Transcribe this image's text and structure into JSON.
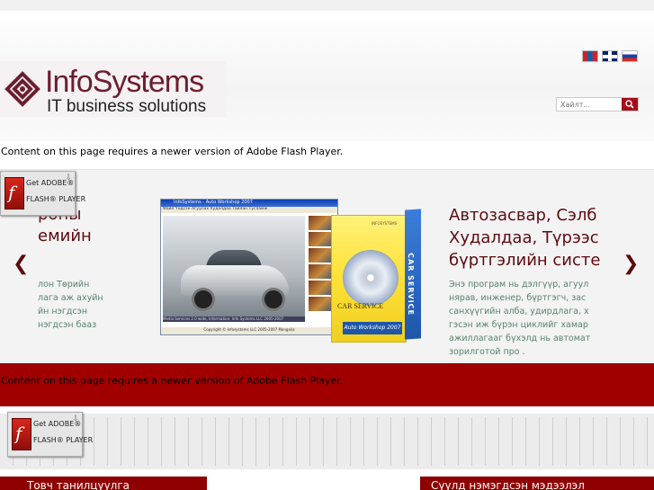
{
  "header": {
    "logo_name": "InfoSystems",
    "logo_tagline": "IT business solutions",
    "languages": [
      "mongolian-flag",
      "english-flag",
      "russian-flag"
    ],
    "search": {
      "placeholder": "Хайлт..."
    }
  },
  "flash": {
    "message": "Content on this page requires a newer version of Adobe Flash Player.",
    "get_label": "Get ADOBE®",
    "player_label": "FLASH® PLAYER"
  },
  "slider": {
    "left_title": "роны\nемийн",
    "left_text": "лон Төрийн\nлага аж ахуйн\nйн нэгдсэн\nнэгдсэн бааз",
    "screenshot": {
      "window_title": "InfoSystems - Auto Workshop 2007",
      "menu": "Файл  Үндсэн  Агуулах  Худалдаа  Тайлан  Тусламж",
      "strip_text": "Media Services 2.0 wide, Information: Info Systems LLC 2005-2007",
      "status": "Copyright © Infosystems LLC 2005-2007 Mongolia"
    },
    "product_box": {
      "top_label": "INFOSYSTEMS",
      "title": "CAR SERVICE",
      "subtitle": "Auto Workshop 2007",
      "side_label": "CAR SERVICE"
    },
    "right_title": "Автозасвар, Сэлб\nХудалдаа, Түрээс\nбүртгэлийн систе",
    "right_text": "Энэ програм нь дэлгүүр, агуул\nнярав, инженер, бүртгэгч, зас\nсанхүүгийн алба, удирдлага, х\nгэсэн иж бүрэн циклийг хамар\nажиллагааг бүхэлд нь автомат\nзорилготой про ."
  },
  "sections": {
    "about_label": "Товч танилцуулга",
    "latest_label": "Сүүлд нэмэгдсэн мэдээлэл"
  },
  "colors": {
    "brand": "#a00000",
    "title": "#5e0a10",
    "text": "#57826d"
  }
}
